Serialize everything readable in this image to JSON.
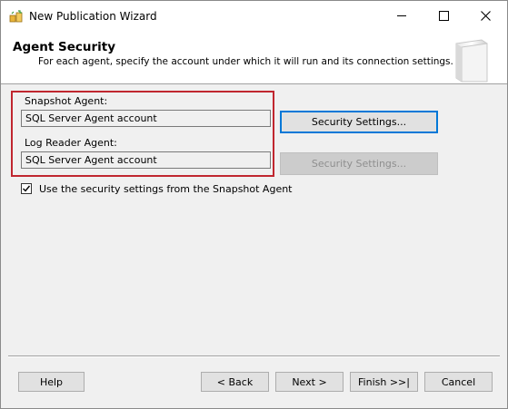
{
  "window": {
    "title": "New Publication Wizard"
  },
  "header": {
    "title": "Agent Security",
    "subtitle": "For each agent, specify the account under which it will run and its connection settings."
  },
  "snapshot_agent": {
    "label": "Snapshot Agent:",
    "value": "SQL Server Agent account",
    "button_label": "Security Settings...",
    "button_enabled": true
  },
  "log_reader_agent": {
    "label": "Log Reader Agent:",
    "value": "SQL Server Agent account",
    "button_label": "Security Settings...",
    "button_enabled": false
  },
  "use_snapshot_settings": {
    "label": "Use the security settings from the Snapshot Agent",
    "checked": true
  },
  "footer": {
    "help": "Help",
    "back": "< Back",
    "next": "Next >",
    "finish": "Finish >>|",
    "cancel": "Cancel"
  },
  "icons": {
    "app": "publication-wizard-icon",
    "header": "wizard-book-graphic",
    "minimize": "minimize-icon",
    "maximize": "maximize-icon",
    "close": "close-icon",
    "check": "checkmark-icon"
  },
  "colors": {
    "highlight_border": "#c0262f",
    "focus_border": "#0078d7"
  }
}
